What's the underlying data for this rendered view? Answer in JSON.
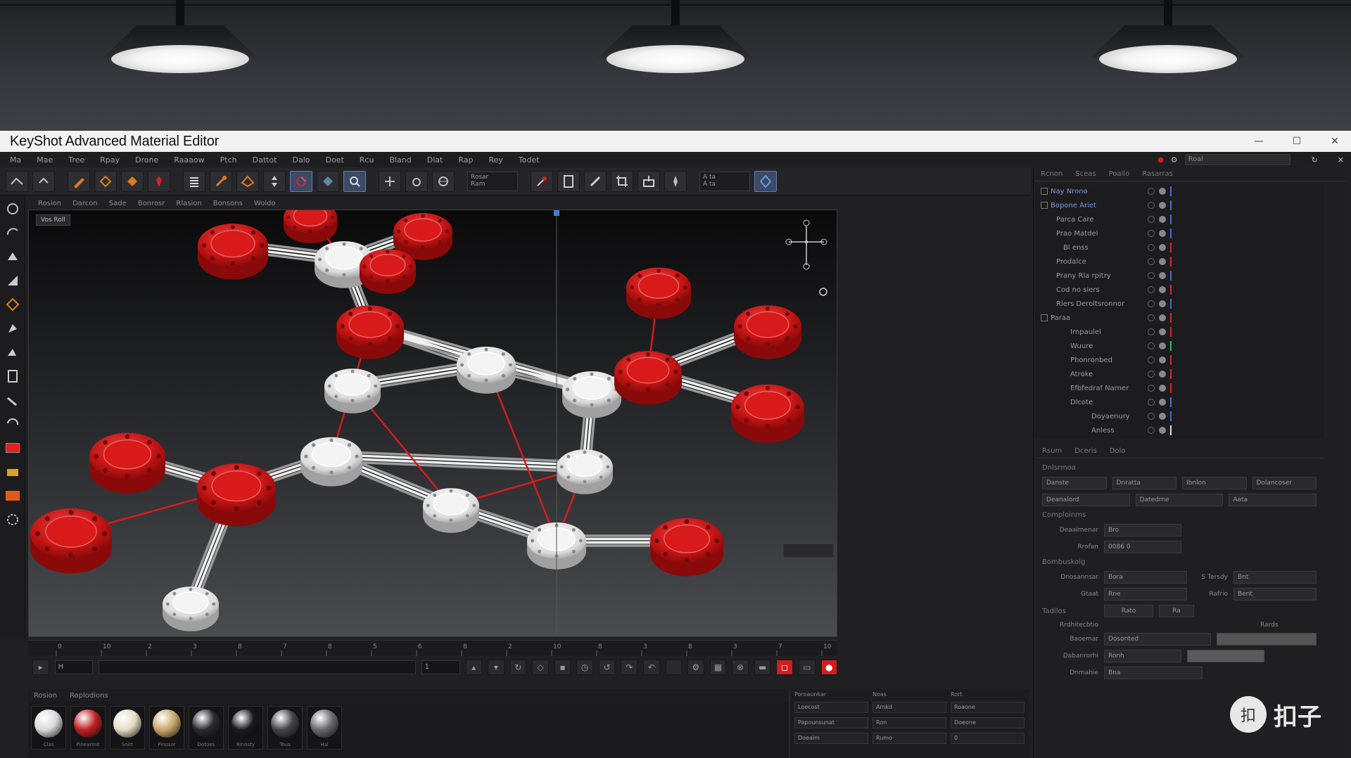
{
  "window": {
    "title": "KeyShot Advanced Material Editor",
    "minimize_icon": "—",
    "maximize_icon": "☐",
    "close_icon": "✕"
  },
  "menu": [
    "Ma",
    "Mae",
    "Tree",
    "Rpay",
    "Drone",
    "Raaaow",
    "Ptch",
    "Dattot",
    "Dalo",
    "Doet",
    "Rcu",
    "Bland",
    "Dlat",
    "Rap",
    "Rey",
    "Todet"
  ],
  "menu_search": "Roal",
  "toolbar": {
    "select1": [
      "Rosar",
      "Ram"
    ],
    "select2": [
      "A ta",
      "A ta"
    ]
  },
  "viewport": {
    "tabs": [
      "Rosion",
      "Darcon",
      "Sade",
      "Bonrosr",
      "Rlasion",
      "Bonsons",
      "Woldo"
    ],
    "label": "Vos Roll"
  },
  "timeline": {
    "ticks": [
      "0",
      "10",
      "2",
      "3",
      "8",
      "7",
      "8",
      "5",
      "6",
      "8",
      "2",
      "10",
      "8",
      "3",
      "8",
      "3",
      "7",
      "10"
    ]
  },
  "transport": {
    "frame_field": "H",
    "frame_value": "1"
  },
  "matlib": {
    "tabs": [
      "Rosion",
      "Roplodions"
    ],
    "swatches": [
      {
        "label": "Clas",
        "color": "#d9d9d9"
      },
      {
        "label": "Pinearmit",
        "color": "#c02020"
      },
      {
        "label": "Snitt",
        "color": "#e6dcc4"
      },
      {
        "label": "Pinosor",
        "color": "#c9a86a"
      },
      {
        "label": "Dotoes",
        "color": "#2a2a30"
      },
      {
        "label": "Rinosty",
        "color": "#1a1a1e"
      },
      {
        "label": "Tous",
        "color": "#444448"
      },
      {
        "label": "Hal",
        "color": "#6a6a6e"
      }
    ]
  },
  "props_bottom": {
    "headers": [
      "Poroaunkar",
      "Noas",
      "Rort"
    ],
    "rows": [
      [
        "Loecost",
        "Amkd",
        "Roaone"
      ],
      [
        "Papounsunat",
        "Ron",
        "Doeone"
      ],
      [
        "Doeaim",
        "Rumo",
        "0"
      ]
    ]
  },
  "right_panel": {
    "tabs": [
      "Rcnon",
      "Sceas",
      "Poallo",
      "Rasarras"
    ],
    "tree": [
      {
        "name": "Nay Nrono",
        "indent": 22,
        "selected": true,
        "bar": "#4a6ad8",
        "check": true
      },
      {
        "name": "Bopone Ariet",
        "indent": 22,
        "selected": true,
        "bar": "#4a6ad8",
        "check": true
      },
      {
        "name": "Parca Care",
        "indent": 30,
        "selected": false,
        "bar": "#4a6ad8"
      },
      {
        "name": "Prao Matdel",
        "indent": 30,
        "selected": false,
        "bar": "#4a6ad8"
      },
      {
        "name": "Bl enss",
        "indent": 40,
        "selected": false,
        "bar": "#d42a2a"
      },
      {
        "name": "Prodalce",
        "indent": 30,
        "selected": false,
        "bar": "#d42a2a"
      },
      {
        "name": "Prany Rla rpitry",
        "indent": 30,
        "selected": false,
        "bar": "#4a6ad8"
      },
      {
        "name": "Cod no siers",
        "indent": 30,
        "selected": false,
        "bar": "#d42a2a"
      },
      {
        "name": "Rlers Deroltsronnor",
        "indent": 30,
        "selected": false,
        "bar": "#4a6ad8"
      },
      {
        "name": "Paraa",
        "indent": 22,
        "selected": false,
        "bar": "#d42a2a",
        "check": true
      },
      {
        "name": "Irnpaulel",
        "indent": 50,
        "selected": false,
        "bar": "#d42a2a"
      },
      {
        "name": "Wuure",
        "indent": 50,
        "selected": false,
        "bar": "#2ac24a"
      },
      {
        "name": "Phonronbed",
        "indent": 50,
        "selected": false,
        "bar": "#d42a2a"
      },
      {
        "name": "Atroke",
        "indent": 50,
        "selected": false,
        "bar": "#d42a2a"
      },
      {
        "name": "Efbfedraf Narner",
        "indent": 50,
        "selected": false,
        "bar": "#d42a2a"
      },
      {
        "name": "Dlcote",
        "indent": 50,
        "selected": false,
        "bar": "#4a6ad8"
      },
      {
        "name": "Doyaenury",
        "indent": 80,
        "selected": false,
        "bar": "#4a6ad8"
      },
      {
        "name": "Anless",
        "indent": 80,
        "selected": false,
        "bar": "#dddddd"
      }
    ],
    "mat_tabs": [
      "Rsum",
      "Dceris",
      "Dolo"
    ],
    "section1": "Dnlsrmoa",
    "drops1": [
      "Danste",
      "Dnratta",
      "Ibnlon",
      "Dolancoser"
    ],
    "drops2": [
      "Deanalord",
      "Datedrne",
      "Aata"
    ],
    "section2": "Comploinms",
    "rows2": [
      {
        "label": "Deaaimenar",
        "value": "Bro"
      },
      {
        "label": "Rrofan",
        "value": "0086 0"
      }
    ],
    "section3": "Bombuskoig",
    "rows3": [
      {
        "label": "Dnosannsar",
        "value": "Bora",
        "label2": "S Tersdy",
        "value2": "Bnt"
      },
      {
        "label": "Gtaat",
        "value": "Rne",
        "label2": "Rafrio",
        "value2": "Bent"
      }
    ],
    "section4": "Tadilos",
    "buttons4": [
      "Rato",
      "Ra"
    ],
    "rows4": [
      {
        "label": "Rrdhitecbtio",
        "value": ""
      },
      {
        "label": "Baoemar",
        "value": "Dosonted"
      },
      {
        "label": "Dabanrorhi",
        "value": "Ronh"
      },
      {
        "label": "Dnmahie",
        "value": "Bna"
      }
    ],
    "extra_label": "Rards"
  },
  "watermark": {
    "text": "扣子",
    "logo": "扣"
  },
  "colors": {
    "accent_red": "#d11e1e",
    "accent_blue": "#4a6ad8",
    "selection_blue": "#7a95d8"
  }
}
